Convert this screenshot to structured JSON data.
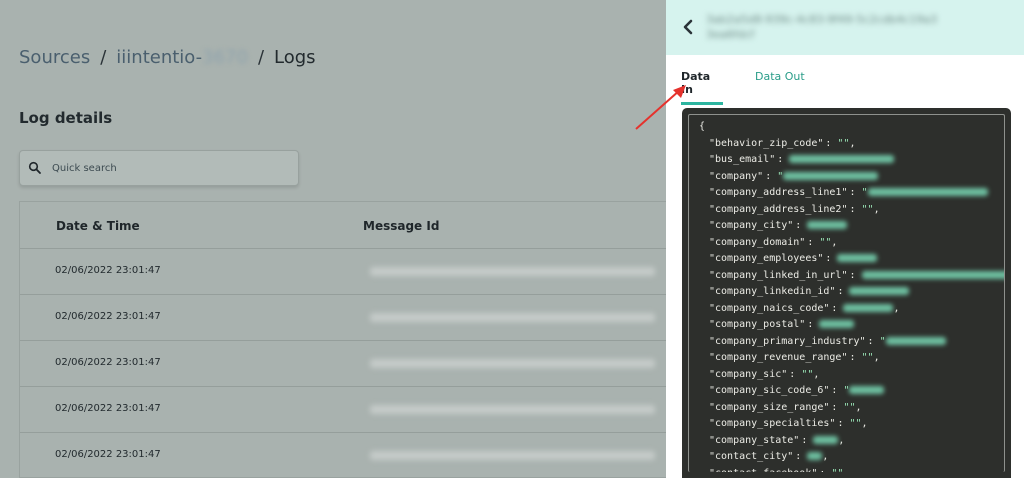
{
  "breadcrumb": {
    "sources": "Sources",
    "sep1": "/",
    "source_name": "iiintentio-",
    "source_name_blurred": "3670",
    "sep2": "/",
    "current": "Logs"
  },
  "log_details": {
    "title": "Log details"
  },
  "search": {
    "placeholder": "Quick search"
  },
  "table": {
    "headers": {
      "date": "Date & Time",
      "message": "Message Id"
    },
    "rows": [
      {
        "date": "02/06/2022 23:01:47",
        "message": ""
      },
      {
        "date": "02/06/2022 23:01:47",
        "message": ""
      },
      {
        "date": "02/06/2022 23:01:47",
        "message": ""
      },
      {
        "date": "02/06/2022 23:01:47",
        "message": ""
      },
      {
        "date": "02/06/2022 23:01:47",
        "message": ""
      }
    ]
  },
  "panel": {
    "title_line1": "3ab2a5d8-939c-4c83-9f49-5c2cdb4c19a3",
    "title_line2": "3ea6fdcf",
    "tabs": {
      "data_in": "Data In",
      "data_out": "Data Out"
    },
    "json_open": "{",
    "fields": [
      {
        "key": "\"behavior_zip_code\"",
        "sep": ":",
        "value": "\"\"",
        "blurred": false,
        "tail": ","
      },
      {
        "key": "\"bus_email\"",
        "sep": ":",
        "value": "",
        "blurred": true,
        "tail": ""
      },
      {
        "key": "\"company\"",
        "sep": ":",
        "value": "\"",
        "blurred": true,
        "tail": ""
      },
      {
        "key": "\"company_address_line1\"",
        "sep": ":",
        "value": "\"",
        "blurred": true,
        "tail": ""
      },
      {
        "key": "\"company_address_line2\"",
        "sep": ":",
        "value": "\"\"",
        "blurred": false,
        "tail": ","
      },
      {
        "key": "\"company_city\"",
        "sep": ":",
        "value": "",
        "blurred": true,
        "tail": ""
      },
      {
        "key": "\"company_domain\"",
        "sep": ":",
        "value": "\"\"",
        "blurred": false,
        "tail": ","
      },
      {
        "key": "\"company_employees\"",
        "sep": ":",
        "value": "",
        "blurred": true,
        "tail": ""
      },
      {
        "key": "\"company_linked_in_url\"",
        "sep": ":",
        "value": "",
        "blurred": true,
        "tail": ""
      },
      {
        "key": "\"company_linkedin_id\"",
        "sep": ":",
        "value": "",
        "blurred": true,
        "tail": ""
      },
      {
        "key": "\"company_naics_code\"",
        "sep": ":",
        "value": "",
        "blurred": true,
        "tail": ","
      },
      {
        "key": "\"company_postal\"",
        "sep": ":",
        "value": "",
        "blurred": true,
        "tail": ""
      },
      {
        "key": "\"company_primary_industry\"",
        "sep": ":",
        "value": "\"",
        "blurred": true,
        "tail": ""
      },
      {
        "key": "\"company_revenue_range\"",
        "sep": ":",
        "value": "\"\"",
        "blurred": false,
        "tail": ","
      },
      {
        "key": "\"company_sic\"",
        "sep": ":",
        "value": "\"\"",
        "blurred": false,
        "tail": ","
      },
      {
        "key": "\"company_sic_code_6\"",
        "sep": ":",
        "value": "\"",
        "blurred": true,
        "tail": ""
      },
      {
        "key": "\"company_size_range\"",
        "sep": ":",
        "value": "\"\"",
        "blurred": false,
        "tail": ","
      },
      {
        "key": "\"company_specialties\"",
        "sep": ":",
        "value": "\"\"",
        "blurred": false,
        "tail": ","
      },
      {
        "key": "\"company_state\"",
        "sep": ":",
        "value": "",
        "blurred": true,
        "tail": ","
      },
      {
        "key": "\"contact_city\"",
        "sep": ":",
        "value": "",
        "blurred": true,
        "tail": ","
      },
      {
        "key": "\"contact_facebook\"",
        "sep": ":",
        "value": "\"\"",
        "blurred": false,
        "tail": ","
      }
    ]
  },
  "colors": {
    "accent": "#2db5a0",
    "panel_header": "#d6f3ee",
    "code_bg": "#2d2f2c",
    "overlay": "#a9b2af",
    "arrow": "#e5322d"
  }
}
